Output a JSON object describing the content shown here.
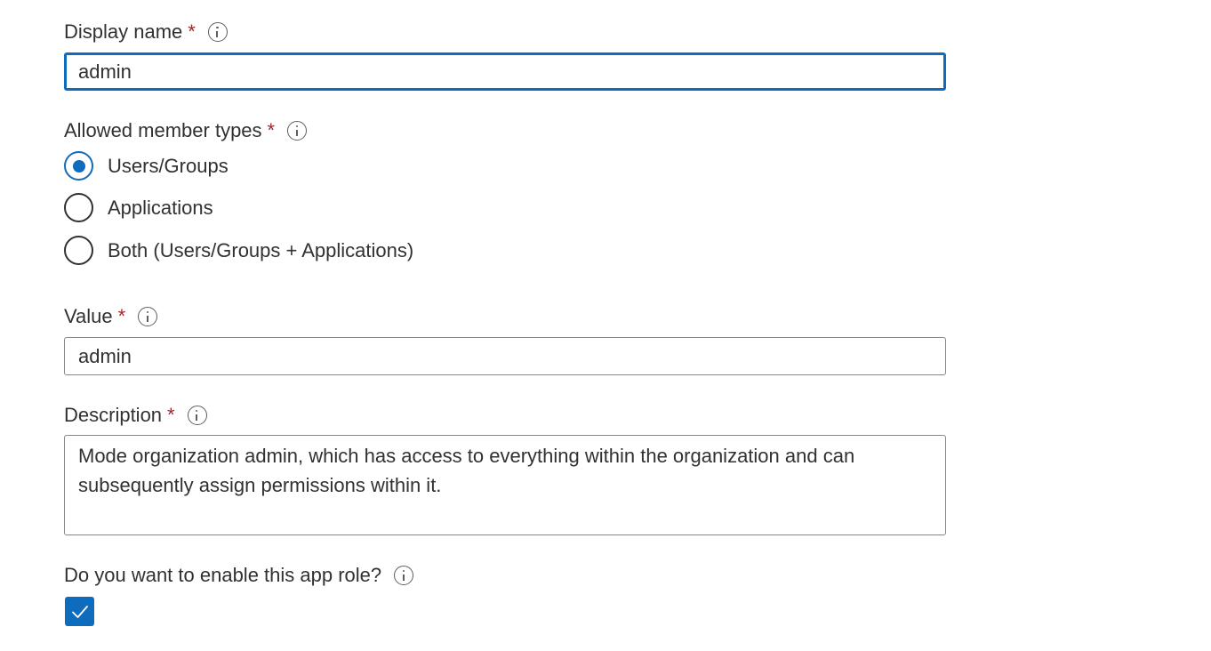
{
  "display_name": {
    "label": "Display name",
    "required_mark": "*",
    "value": "admin"
  },
  "member_types": {
    "label": "Allowed member types",
    "required_mark": "*",
    "options": [
      {
        "label": "Users/Groups",
        "checked": true
      },
      {
        "label": "Applications",
        "checked": false
      },
      {
        "label": "Both (Users/Groups + Applications)",
        "checked": false
      }
    ]
  },
  "value_field": {
    "label": "Value",
    "required_mark": "*",
    "value": "admin"
  },
  "description": {
    "label": "Description",
    "required_mark": "*",
    "value": "Mode organization admin, which has access to everything within the organization and can subsequently assign permissions within it."
  },
  "enable_role": {
    "label": "Do you want to enable this app role?",
    "checked": true
  },
  "colors": {
    "accent": "#0f6cbd",
    "required": "#a4262c",
    "text": "#323130",
    "border": "#8a8886"
  },
  "icons": {
    "info": "info-icon",
    "check": "checkmark-icon"
  }
}
